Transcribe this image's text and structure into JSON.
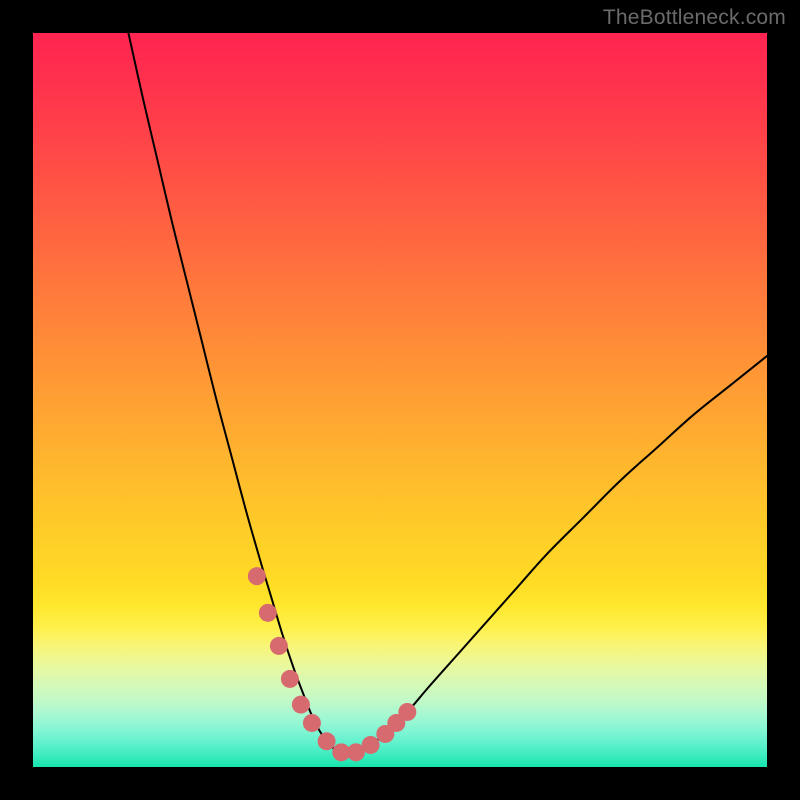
{
  "watermark": "TheBottleneck.com",
  "chart_data": {
    "type": "line",
    "title": "",
    "xlabel": "",
    "ylabel": "",
    "xlim": [
      0,
      100
    ],
    "ylim": [
      0,
      100
    ],
    "grid": false,
    "legend": false,
    "series": [
      {
        "name": "bottleneck-curve",
        "x": [
          13,
          15,
          17,
          19,
          21,
          23,
          25,
          27,
          29,
          31,
          32.5,
          34,
          35.5,
          37,
          38,
          39,
          40,
          41,
          42,
          43,
          45,
          48,
          51,
          54,
          58,
          62,
          66,
          70,
          75,
          80,
          85,
          90,
          95,
          100
        ],
        "values": [
          100,
          91,
          82.5,
          74,
          66,
          58,
          50,
          42.5,
          35,
          28,
          23,
          18,
          13.5,
          9.5,
          7,
          5,
          3.5,
          2.5,
          2,
          2,
          2.5,
          4.5,
          7.5,
          11,
          15.5,
          20,
          24.5,
          29,
          34,
          39,
          43.5,
          48,
          52,
          56
        ]
      }
    ],
    "markers": [
      {
        "name": "highlight-dots",
        "x": [
          30.5,
          32,
          33.5,
          35,
          36.5,
          38,
          40,
          42,
          44,
          46,
          48,
          49.5,
          51
        ],
        "values": [
          26,
          21,
          16.5,
          12,
          8.5,
          6,
          3.5,
          2,
          2,
          3,
          4.5,
          6,
          7.5
        ]
      }
    ]
  },
  "colors": {
    "curve": "#000000",
    "marker": "#d76a6f",
    "watermark": "#6b6b6b",
    "frame": "#000000"
  }
}
